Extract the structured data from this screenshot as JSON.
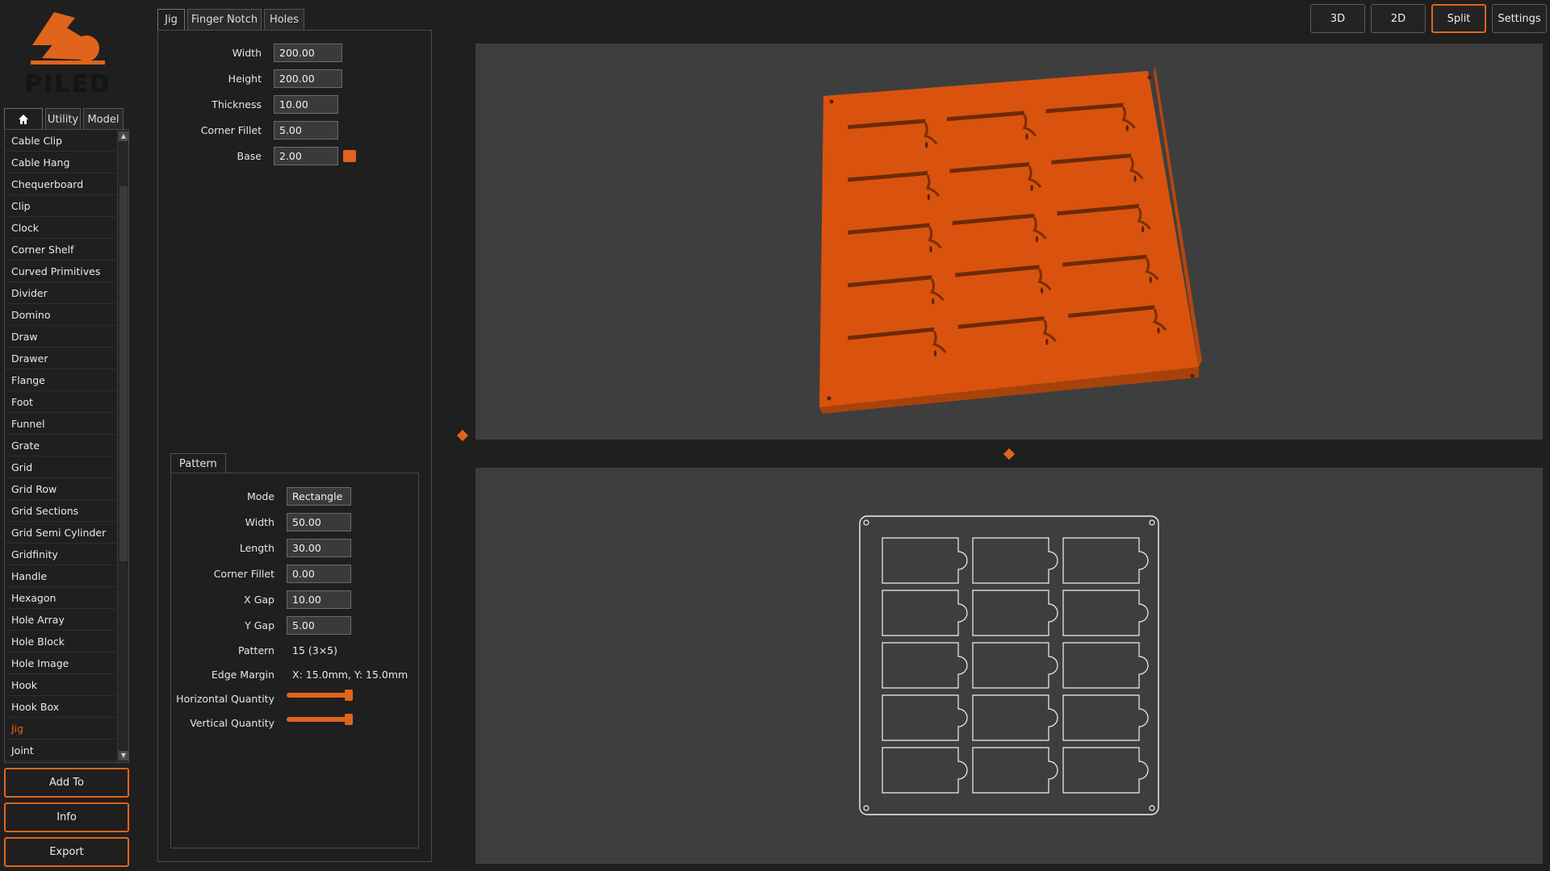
{
  "logo": {
    "text": "PILED"
  },
  "sidebar": {
    "tabs": [
      {
        "label": "",
        "icon": "home-icon"
      },
      {
        "label": "Utility"
      },
      {
        "label": "Model"
      }
    ],
    "items": [
      "Cable Clip",
      "Cable Hang",
      "Chequerboard",
      "Clip",
      "Clock",
      "Corner Shelf",
      "Curved Primitives",
      "Divider",
      "Domino",
      "Draw",
      "Drawer",
      "Flange",
      "Foot",
      "Funnel",
      "Grate",
      "Grid",
      "Grid Row",
      "Grid Sections",
      "Grid Semi Cylinder",
      "Gridfinity",
      "Handle",
      "Hexagon",
      "Hole Array",
      "Hole Block",
      "Hole Image",
      "Hook",
      "Hook Box",
      "Jig",
      "Joint"
    ],
    "active_item": "Jig",
    "buttons": {
      "add_to": "Add To",
      "info": "Info",
      "export": "Export"
    }
  },
  "panel": {
    "tabs": [
      "Jig",
      "Finger Notch",
      "Holes"
    ],
    "active_tab": "Jig",
    "fields": {
      "width": {
        "label": "Width",
        "value": "200.00"
      },
      "height": {
        "label": "Height",
        "value": "200.00"
      },
      "thickness": {
        "label": "Thickness",
        "value": "10.00"
      },
      "corner_fillet": {
        "label": "Corner Fillet",
        "value": "5.00"
      },
      "base": {
        "label": "Base",
        "value": "2.00"
      }
    },
    "base_color": "#e0641c",
    "pattern": {
      "tab": "Pattern",
      "mode": {
        "label": "Mode",
        "value": "Rectangle"
      },
      "width": {
        "label": "Width",
        "value": "50.00"
      },
      "length": {
        "label": "Length",
        "value": "30.00"
      },
      "corner_fillet": {
        "label": "Corner Fillet",
        "value": "0.00"
      },
      "x_gap": {
        "label": "X Gap",
        "value": "10.00"
      },
      "y_gap": {
        "label": "Y Gap",
        "value": "5.00"
      },
      "pattern": {
        "label": "Pattern",
        "value": "15 (3×5)"
      },
      "edge_margin": {
        "label": "Edge Margin",
        "value": "X: 15.0mm, Y: 15.0mm"
      },
      "horizontal_quantity": {
        "label": "Horizontal Quantity",
        "level": 1.0
      },
      "vertical_quantity": {
        "label": "Vertical Quantity",
        "level": 1.0
      }
    }
  },
  "view_buttons": {
    "b3d": "3D",
    "b2d": "2D",
    "split": "Split",
    "settings": "Settings",
    "active": "Split"
  },
  "colors": {
    "accent": "#e0641c",
    "model": "#d9530e",
    "viewport": "#3e3e3e",
    "background": "#1f1f1f"
  }
}
